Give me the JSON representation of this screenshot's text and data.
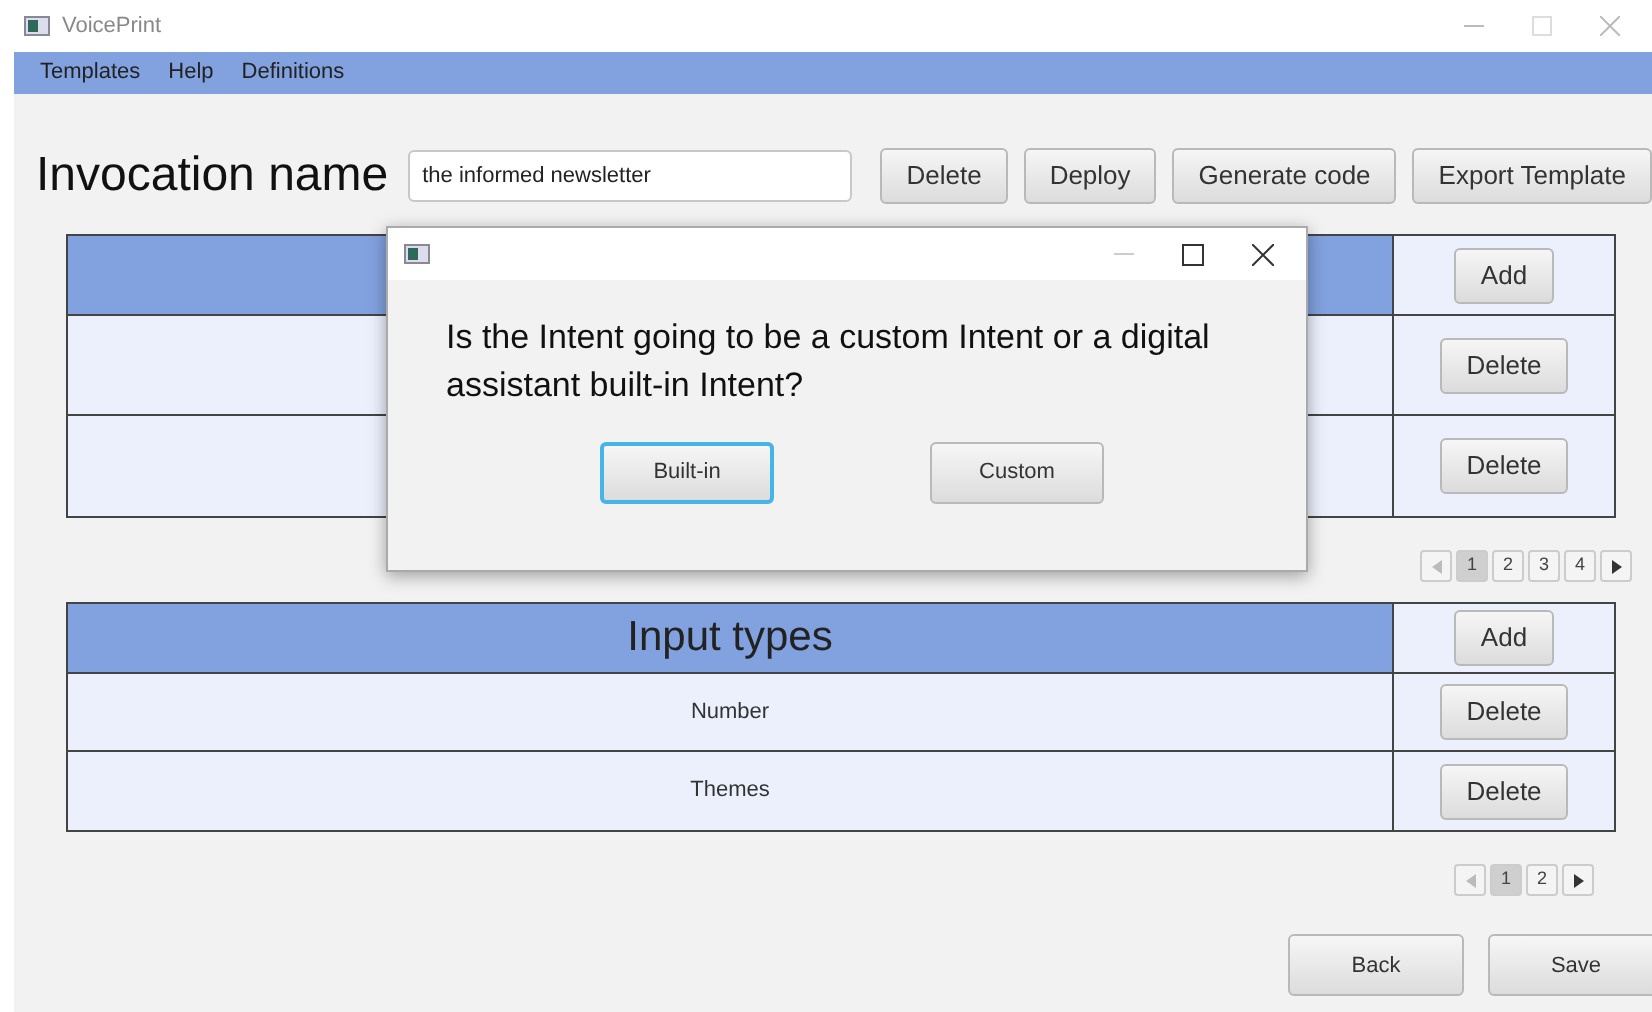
{
  "window": {
    "title": "VoicePrint"
  },
  "menu": [
    "Templates",
    "Help",
    "Definitions"
  ],
  "invocation": {
    "label": "Invocation name",
    "value": "the informed newsletter"
  },
  "toolbar_buttons": [
    "Delete",
    "Deploy",
    "Generate code",
    "Export Template"
  ],
  "intent_table": {
    "header_button": "Add",
    "rows": [
      {
        "button": "Delete"
      },
      {
        "button": "Delete"
      }
    ],
    "pagination": [
      {
        "label": "1",
        "selected": true
      },
      {
        "label": "2",
        "selected": false
      },
      {
        "label": "3",
        "selected": false
      },
      {
        "label": "4",
        "selected": false
      }
    ]
  },
  "input_types_table": {
    "title": "Input types",
    "header_button": "Add",
    "rows": [
      {
        "name": "Number",
        "button": "Delete"
      },
      {
        "name": "Themes",
        "button": "Delete"
      }
    ],
    "pagination": [
      {
        "label": "1",
        "selected": true
      },
      {
        "label": "2",
        "selected": false
      }
    ]
  },
  "footer_buttons": [
    "Back",
    "Save"
  ],
  "dialog": {
    "message": "Is the Intent going to be a custom Intent or a digital assistant built-in Intent?",
    "buttons": [
      {
        "label": "Built-in",
        "focused": true
      },
      {
        "label": "Custom",
        "focused": false
      }
    ]
  }
}
